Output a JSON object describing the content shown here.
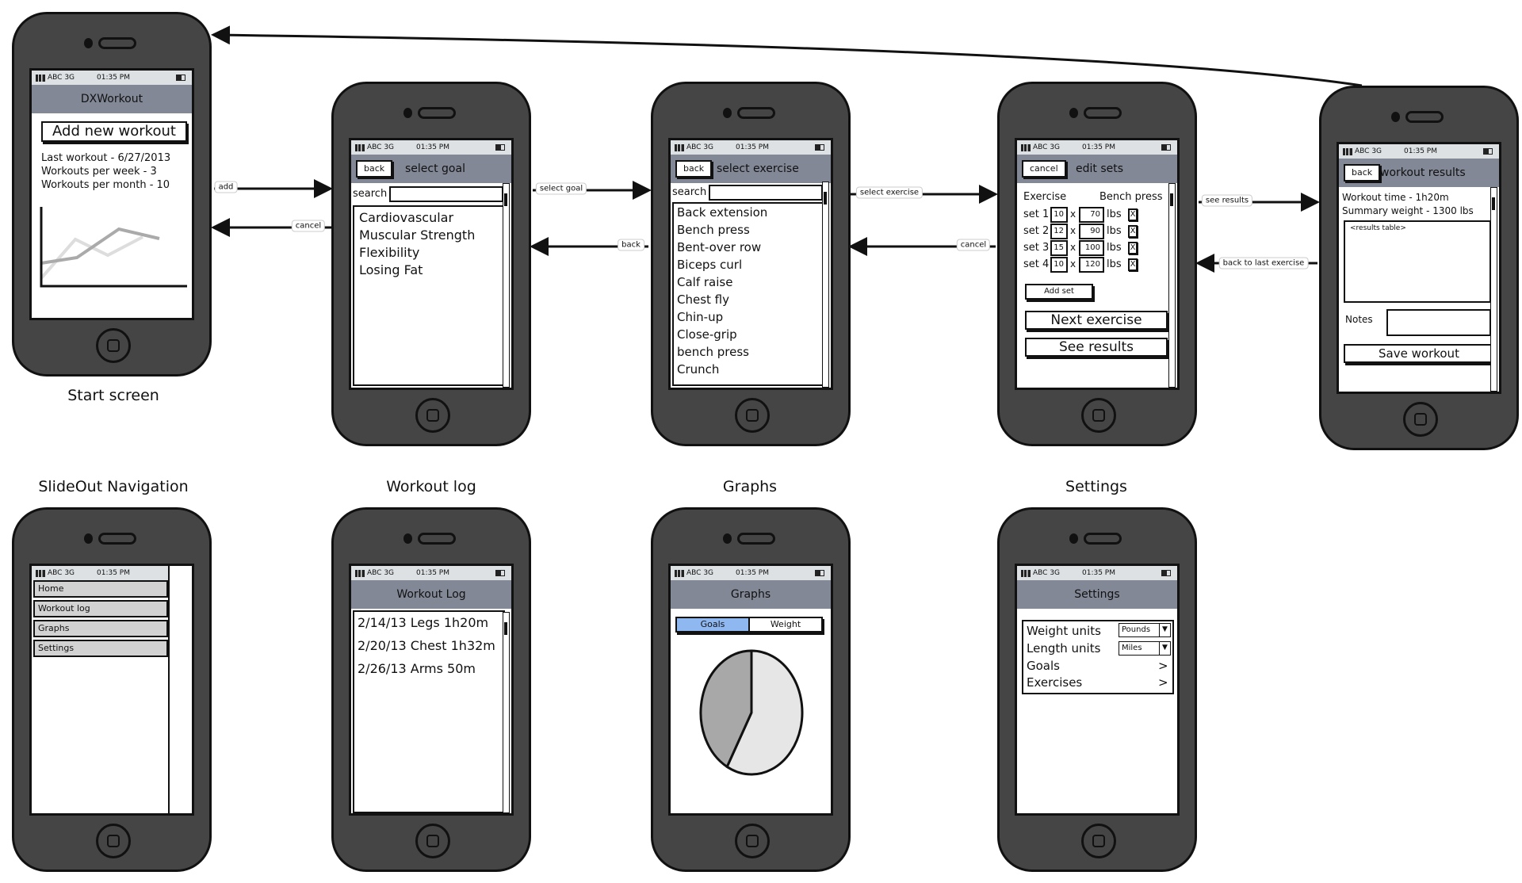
{
  "status": {
    "carrier": "ABC 3G",
    "time": "01:35 PM"
  },
  "start": {
    "label": "Start screen",
    "title": "DXWorkout",
    "add_button": "Add new workout",
    "stats": [
      "Last workout - 6/27/2013",
      "Workouts per week - 3",
      "Workouts per month - 10"
    ]
  },
  "goal": {
    "back": "back",
    "title": "select goal",
    "search_label": "search",
    "search_value": "",
    "items": [
      "Cardiovascular",
      "Muscular Strength",
      "Flexibility",
      "Losing Fat"
    ]
  },
  "exercise": {
    "back": "back",
    "title": "select exercise",
    "search_label": "search",
    "search_value": "",
    "items": [
      "Back extension",
      "Bench press",
      "Bent-over row",
      "Biceps curl",
      "Calf raise",
      "Chest fly",
      "Chin-up",
      "Close-grip",
      "bench press",
      "Crunch"
    ]
  },
  "sets": {
    "cancel": "cancel",
    "title": "edit sets",
    "exercise_label": "Exercise",
    "exercise_value": "Bench press",
    "rows": [
      {
        "label": "set 1",
        "reps": "10",
        "weight": "70"
      },
      {
        "label": "set 2",
        "reps": "12",
        "weight": "90"
      },
      {
        "label": "set 3",
        "reps": "15",
        "weight": "100"
      },
      {
        "label": "set 4",
        "reps": "10",
        "weight": "120"
      }
    ],
    "times": "x",
    "unit": "lbs",
    "remove": "X",
    "add_set": "Add set",
    "next": "Next exercise",
    "see_results": "See results"
  },
  "results": {
    "back": "back",
    "title": "workout results",
    "time": "Workout time - 1h20m",
    "weight": "Summary weight - 1300 lbs",
    "table_placeholder": "<results table>",
    "notes_label": "Notes",
    "notes_value": "",
    "save": "Save workout"
  },
  "slideout": {
    "label": "SlideOut Navigation",
    "items": [
      "Home",
      "Workout log",
      "Graphs",
      "Settings"
    ]
  },
  "log": {
    "label": "Workout log",
    "title": "Workout Log",
    "items": [
      "2/14/13 Legs 1h20m",
      "2/20/13 Chest 1h32m",
      "2/26/13 Arms 50m"
    ]
  },
  "graphs": {
    "label": "Graphs",
    "title": "Graphs",
    "tabs": [
      "Goals",
      "Weight"
    ],
    "active_tab": "Goals",
    "accent": "#8fb8f0",
    "pie_slices": [
      42,
      58
    ],
    "pie_colors": [
      "#a8a8a8",
      "#e6e6e6"
    ]
  },
  "settings": {
    "label": "Settings",
    "title": "Settings",
    "weight_label": "Weight units",
    "weight_value": "Pounds",
    "length_label": "Length units",
    "length_value": "Miles",
    "goals": "Goals",
    "exercises": "Exercises",
    "chevron": ">"
  },
  "arrows": {
    "add": "add",
    "cancel1": "cancel",
    "select_goal": "select goal",
    "back": "back",
    "select_exercise": "select exercise",
    "cancel2": "cancel",
    "see_results": "see results",
    "back_last": "back to last exercise"
  }
}
